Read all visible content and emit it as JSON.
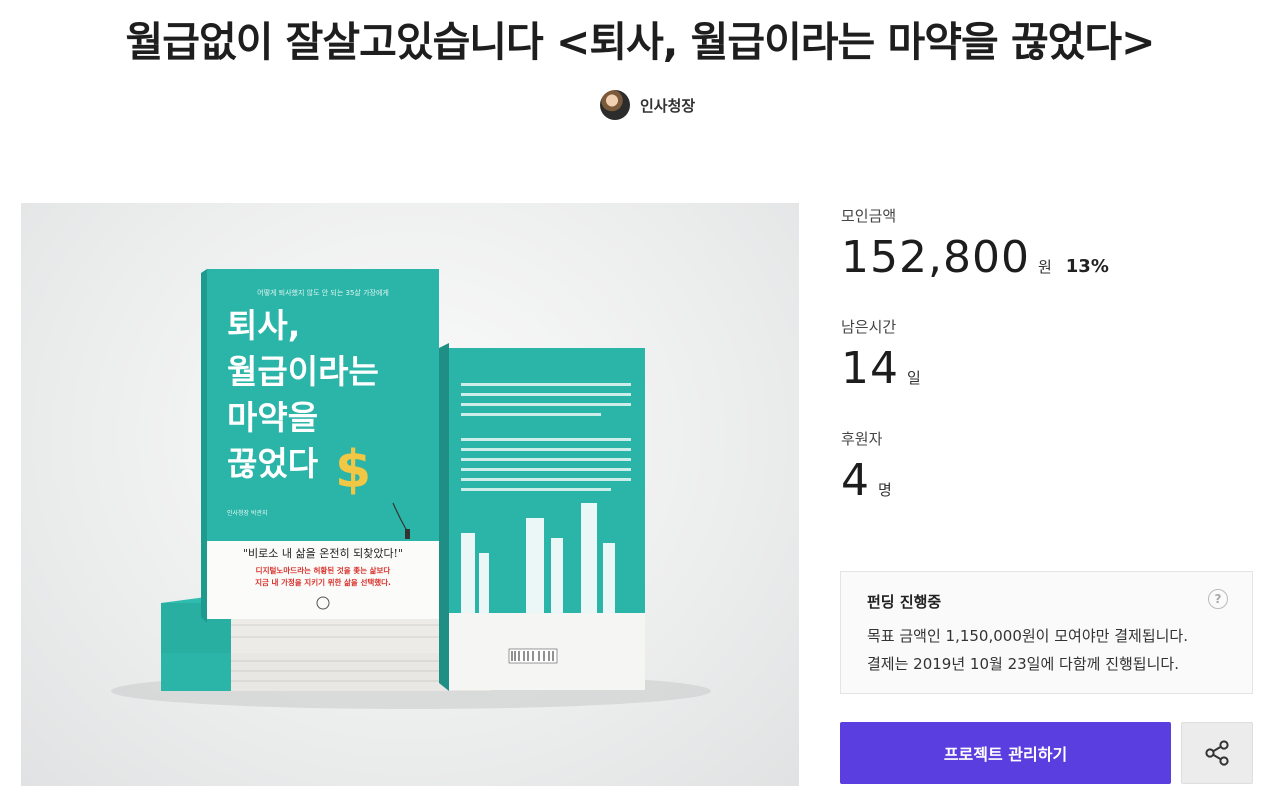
{
  "project": {
    "title": "월급없이 잘살고있습니다 <퇴사, 월급이라는 마약을 끊었다>",
    "creator": "인사청장"
  },
  "cover": {
    "front_subtitle": "어떻게 퇴사했지 않도 안 되는 35살 가장에게",
    "front_title_lines": [
      "퇴사,",
      "월급이라는",
      "마약을",
      "끊었다"
    ],
    "dollar": "$",
    "author": "인사청장 박관지",
    "quote": "\"비로소 내 삶을 온전히 되찾았다!\"",
    "tagline_1": "디지털노마드라는 허황된 것을 좇는 삶보다",
    "tagline_2": "지금 내 가정을 지키기 위한 삶을 선택했다."
  },
  "stats": {
    "raised_label": "모인금액",
    "raised_value": "152,800",
    "raised_unit": "원",
    "raised_percent": "13%",
    "remaining_label": "남은시간",
    "remaining_value": "14",
    "remaining_unit": "일",
    "backers_label": "후원자",
    "backers_value": "4",
    "backers_unit": "명"
  },
  "funding": {
    "status": "펀딩 진행중",
    "help": "?",
    "line1": "목표 금액인 1,150,000원이 모여야만 결제됩니다.",
    "line2": "결제는 2019년 10월 23일에 다함께 진행됩니다."
  },
  "actions": {
    "manage_label": "프로젝트 관리하기"
  },
  "colors": {
    "accent": "#5a3ee0",
    "book_teal": "#2bb5a8"
  }
}
